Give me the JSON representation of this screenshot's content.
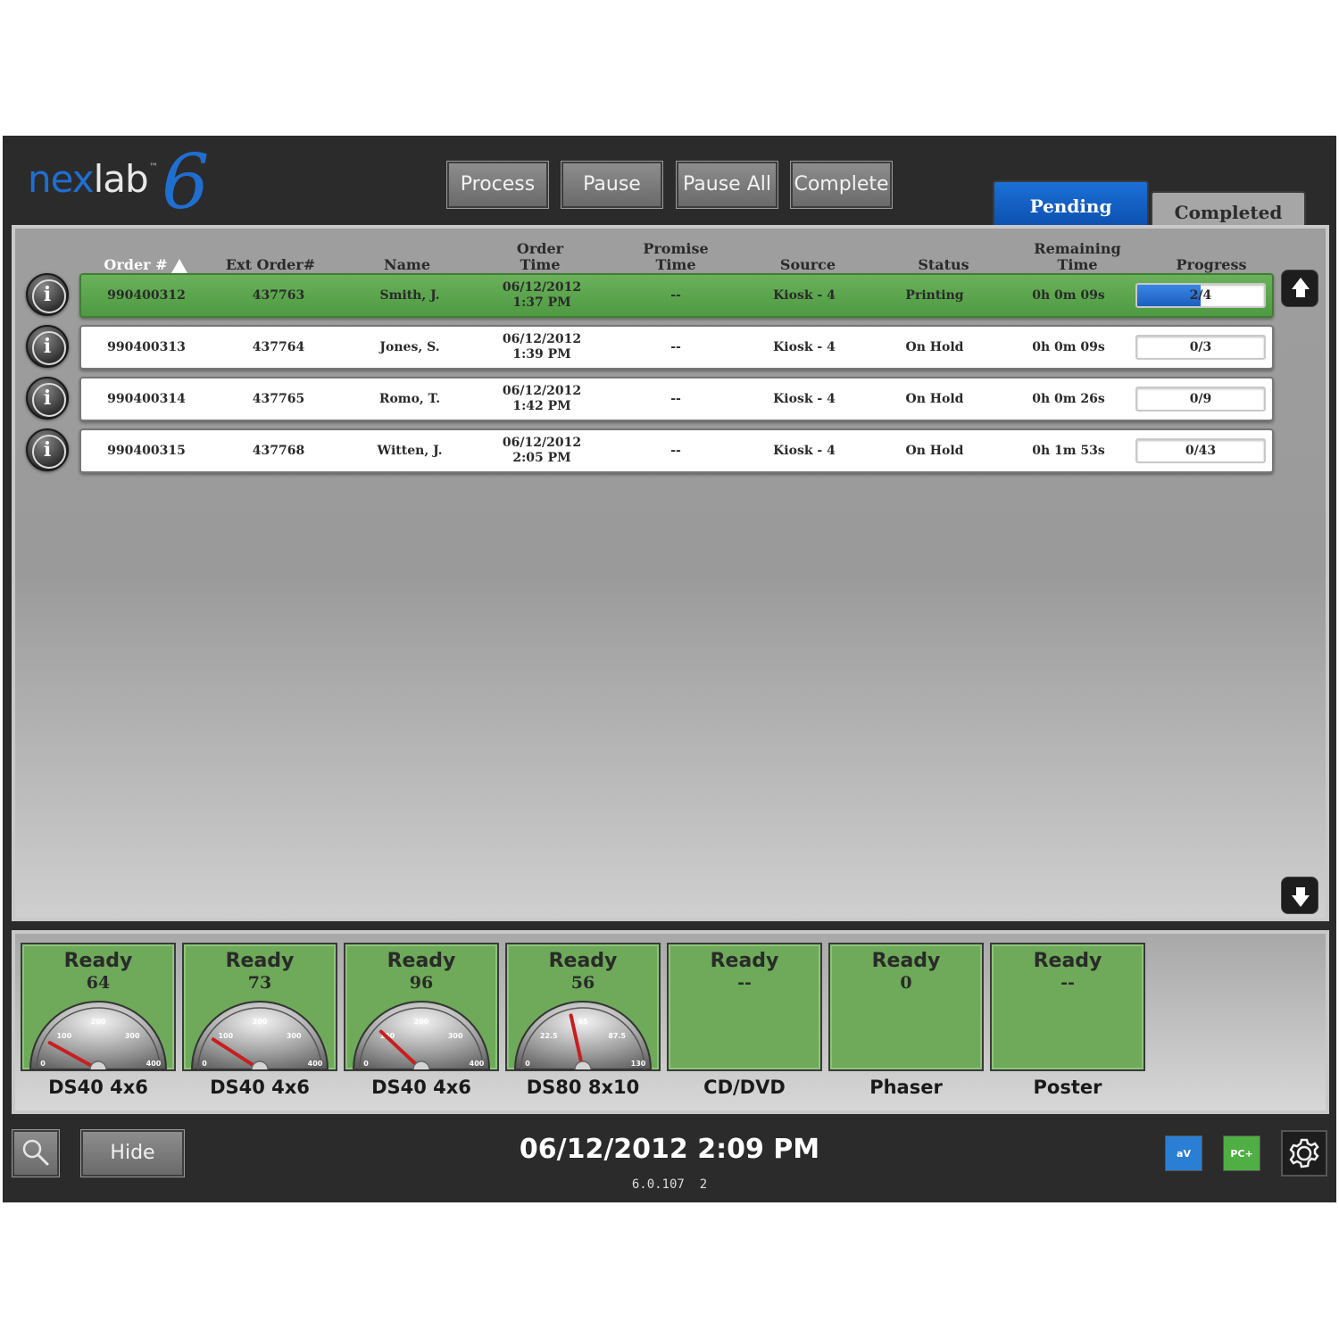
{
  "app": {
    "logo": {
      "text_a": "nex",
      "text_b": "lab",
      "tm": "™",
      "mark": "6"
    },
    "toolbar": {
      "process": "Process",
      "pause": "Pause",
      "pause_all": "Pause All",
      "complete": "Complete"
    },
    "tabs": [
      {
        "label": "Pending",
        "selected": true
      },
      {
        "label": "Completed",
        "selected": false
      }
    ]
  },
  "orders": {
    "columns": {
      "order_no": "Order #",
      "ext_order": "Ext Order#",
      "name": "Name",
      "order_time": "Order\nTime",
      "promise_time": "Promise\nTime",
      "source": "Source",
      "status": "Status",
      "remaining_time": "Remaining\nTime",
      "progress": "Progress"
    },
    "sort_column": "Order #",
    "rows": [
      {
        "order_no": "990400312",
        "ext_order": "437763",
        "name": "Smith, J.",
        "order_date": "06/12/2012",
        "order_time": "1:37 PM",
        "promise_time": "--",
        "source": "Kiosk - 4",
        "status": "Printing",
        "remaining": "0h 0m 09s",
        "progress_text": "2/4",
        "progress_fraction": 0.5,
        "active": true
      },
      {
        "order_no": "990400313",
        "ext_order": "437764",
        "name": "Jones, S.",
        "order_date": "06/12/2012",
        "order_time": "1:39 PM",
        "promise_time": "--",
        "source": "Kiosk - 4",
        "status": "On Hold",
        "remaining": "0h 0m 09s",
        "progress_text": "0/3",
        "progress_fraction": 0,
        "active": false
      },
      {
        "order_no": "990400314",
        "ext_order": "437765",
        "name": "Romo, T.",
        "order_date": "06/12/2012",
        "order_time": "1:42 PM",
        "promise_time": "--",
        "source": "Kiosk - 4",
        "status": "On Hold",
        "remaining": "0h 0m 26s",
        "progress_text": "0/9",
        "progress_fraction": 0,
        "active": false
      },
      {
        "order_no": "990400315",
        "ext_order": "437768",
        "name": "Witten, J.",
        "order_date": "06/12/2012",
        "order_time": "2:05 PM",
        "promise_time": "--",
        "source": "Kiosk - 4",
        "status": "On Hold",
        "remaining": "0h 1m 53s",
        "progress_text": "0/43",
        "progress_fraction": 0,
        "active": false
      }
    ]
  },
  "printers": [
    {
      "status": "Ready",
      "count": "64",
      "name": "DS40 4x6",
      "gauge": {
        "labels": [
          "0",
          "100",
          "200",
          "300",
          "400"
        ],
        "max": 400,
        "value": 64
      }
    },
    {
      "status": "Ready",
      "count": "73",
      "name": "DS40 4x6",
      "gauge": {
        "labels": [
          "0",
          "100",
          "200",
          "300",
          "400"
        ],
        "max": 400,
        "value": 73
      }
    },
    {
      "status": "Ready",
      "count": "96",
      "name": "DS40 4x6",
      "gauge": {
        "labels": [
          "0",
          "100",
          "200",
          "300",
          "400"
        ],
        "max": 400,
        "value": 96
      }
    },
    {
      "status": "Ready",
      "count": "56",
      "name": "DS80 8x10",
      "gauge": {
        "labels": [
          "0",
          "22.5",
          "65",
          "87.5",
          "130"
        ],
        "max": 130,
        "value": 56
      }
    },
    {
      "status": "Ready",
      "count": "--",
      "name": "CD/DVD",
      "gauge": null
    },
    {
      "status": "Ready",
      "count": "0",
      "name": "Phaser",
      "gauge": null
    },
    {
      "status": "Ready",
      "count": "--",
      "name": "Poster",
      "gauge": null
    }
  ],
  "footer": {
    "hide": "Hide",
    "datetime": "06/12/2012 2:09 PM",
    "version": "6.0.107  2",
    "badges": {
      "av": "aV",
      "pc": "PC+"
    },
    "icons": {
      "search": "search-icon",
      "settings": "gear-icon",
      "info": "info-icon"
    }
  },
  "colors": {
    "active_row": "#5aa64c",
    "tab_selected": "#1160c4",
    "progress_fill": "#1b5fbf",
    "printer_tile": "#6eaa59",
    "gauge_needle": "#c81e1e"
  }
}
